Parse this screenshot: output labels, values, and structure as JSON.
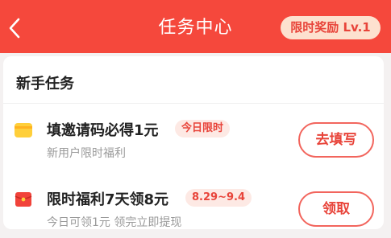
{
  "header": {
    "title": "任务中心",
    "level_badge": "限时奖励 Lv.1"
  },
  "colors": {
    "header_bg": "#f5483c",
    "accent": "#e8443a",
    "tag_bg": "#fde9e4",
    "badge_bg": "#fde1cf"
  },
  "section": {
    "title": "新手任务"
  },
  "tasks": [
    {
      "icon": "coupon-icon",
      "name": "填邀请码必得1元",
      "tag": "今日限时",
      "subtitle": "新用户限时福利",
      "button": "去填写"
    },
    {
      "icon": "red-envelope-icon",
      "name": "限时福利7天领8元",
      "tag": "8.29~9.4",
      "subtitle": "今日可领1元 领完立即提现",
      "button": "领取"
    }
  ]
}
